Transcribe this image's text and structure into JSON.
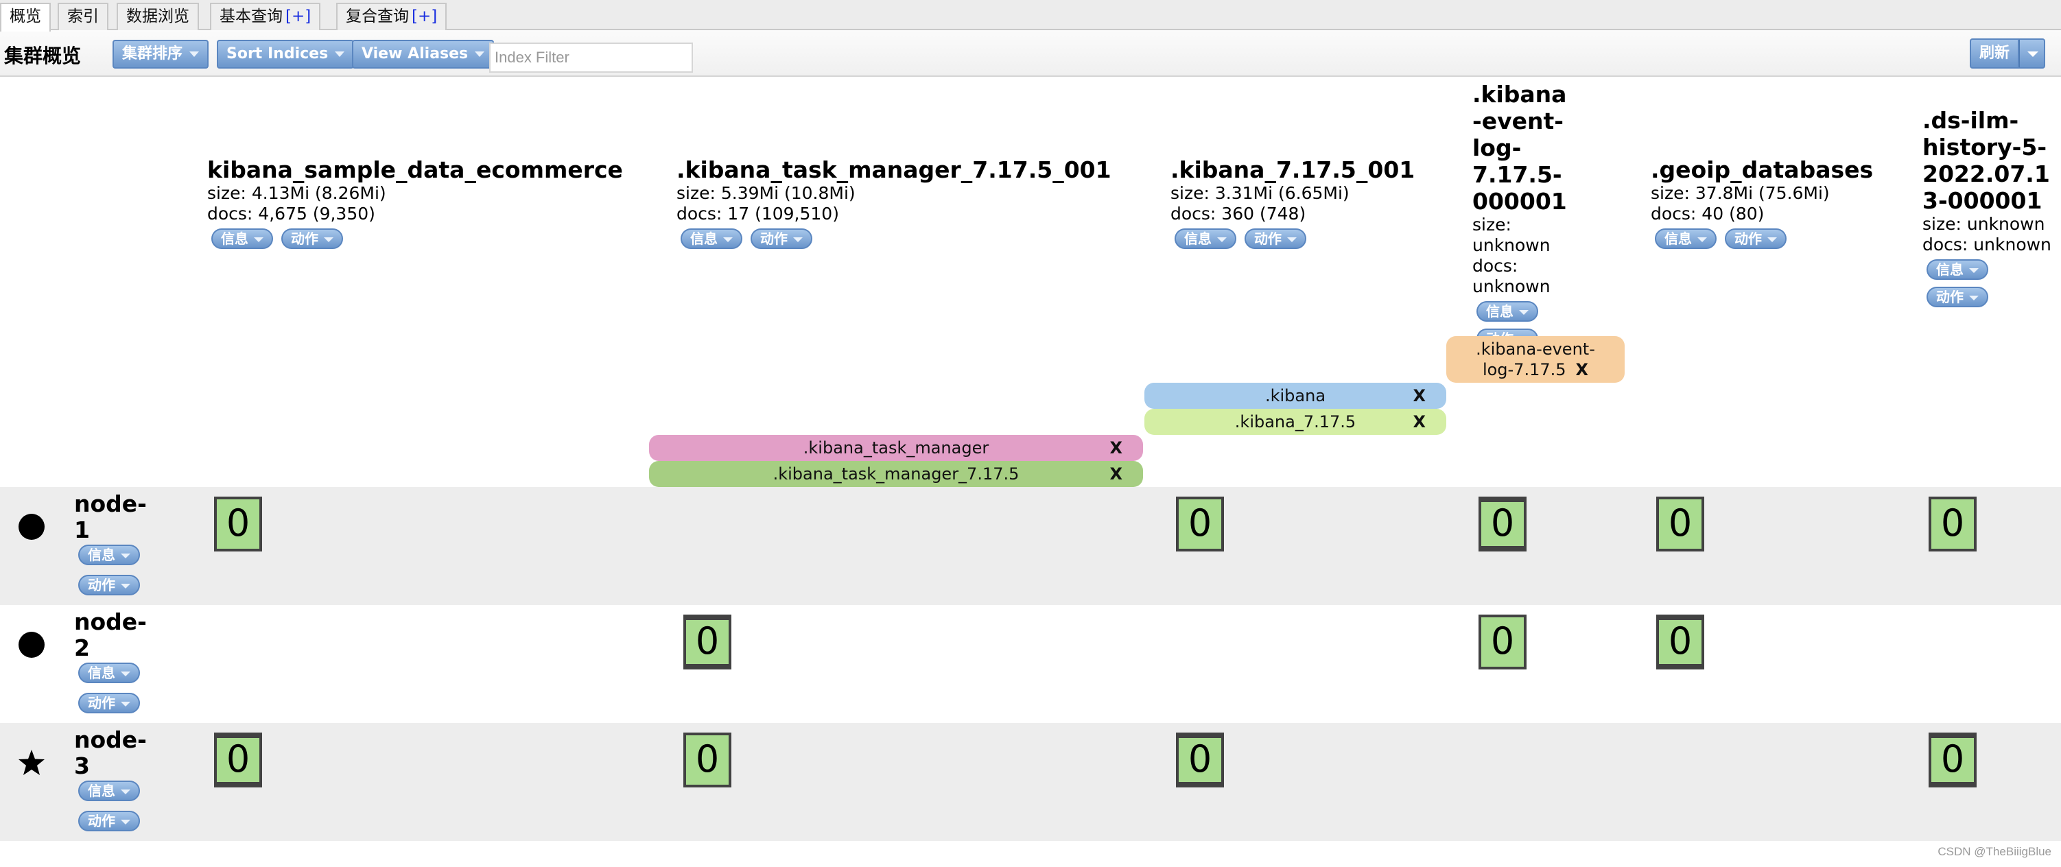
{
  "tabs": [
    {
      "label": "概览",
      "plus": null,
      "active": true
    },
    {
      "label": "索引",
      "plus": null,
      "active": false
    },
    {
      "label": "数据浏览",
      "plus": null,
      "active": false
    },
    {
      "label": "基本查询",
      "plus": "[+]",
      "active": false
    },
    {
      "label": "复合查询",
      "plus": "[+]",
      "active": false
    }
  ],
  "toolbar": {
    "title": "集群概览",
    "cluster_sort_label": "集群排序",
    "sort_indices_label": "Sort Indices",
    "view_aliases_label": "View Aliases",
    "index_filter_placeholder": "Index Filter",
    "index_filter_value": "",
    "refresh_label": "刷新"
  },
  "pill_labels": {
    "info": "信息",
    "actions": "动作"
  },
  "indices": [
    {
      "name": "kibana_sample_data_ecommerce",
      "size": "size: 4.13Mi (8.26Mi)",
      "docs": "docs: 4,675 (9,350)"
    },
    {
      "name": ".kibana_task_manager_7.17.5_001",
      "size": "size: 5.39Mi (10.8Mi)",
      "docs": "docs: 17 (109,510)"
    },
    {
      "name": ".kibana_7.17.5_001",
      "size": "size: 3.31Mi (6.65Mi)",
      "docs": "docs: 360 (748)"
    },
    {
      "name": ".kibana-event-log-7.17.5-000001",
      "size": "size: unknown",
      "docs": "docs: unknown"
    },
    {
      "name": ".geoip_databases",
      "size": "size: 37.8Mi (75.6Mi)",
      "docs": "docs: 40 (80)"
    },
    {
      "name": ".ds-ilm-history-5-2022.07.13-000001",
      "size": "size: unknown",
      "docs": "docs: unknown"
    }
  ],
  "aliases": [
    {
      "name": ".kibana_task_manager",
      "index": ".kibana_task_manager_7.17.5_001",
      "color": "#e29fc7",
      "remove": "X"
    },
    {
      "name": ".kibana_task_manager_7.17.5",
      "index": ".kibana_task_manager_7.17.5_001",
      "color": "#a6ce82",
      "remove": "X"
    },
    {
      "name": ".kibana",
      "index": ".kibana_7.17.5_001",
      "color": "#a6cbec",
      "remove": "X"
    },
    {
      "name": ".kibana_7.17.5",
      "index": ".kibana_7.17.5_001",
      "color": "#d4eea4",
      "remove": "X"
    },
    {
      "name": ".kibana-event-log-7.17.5",
      "index": ".kibana-event-log-7.17.5-000001",
      "color": "#f7cfa0",
      "remove": "X"
    }
  ],
  "nodes": [
    {
      "name": "node-1",
      "icon": "circle",
      "shards": [
        {
          "index": 0,
          "label": "0",
          "primary": false
        },
        {
          "index": 2,
          "label": "0",
          "primary": false
        },
        {
          "index": 3,
          "label": "0",
          "primary": true
        },
        {
          "index": 4,
          "label": "0",
          "primary": false
        },
        {
          "index": 5,
          "label": "0",
          "primary": false
        }
      ]
    },
    {
      "name": "node-2",
      "icon": "circle",
      "shards": [
        {
          "index": 1,
          "label": "0",
          "primary": true
        },
        {
          "index": 3,
          "label": "0",
          "primary": false
        },
        {
          "index": 4,
          "label": "0",
          "primary": true
        }
      ]
    },
    {
      "name": "node-3",
      "icon": "star",
      "shards": [
        {
          "index": 0,
          "label": "0",
          "primary": true
        },
        {
          "index": 1,
          "label": "0",
          "primary": false
        },
        {
          "index": 2,
          "label": "0",
          "primary": true
        },
        {
          "index": 5,
          "label": "0",
          "primary": true
        }
      ]
    }
  ],
  "colors": {
    "shard_fill": "#a9dc8f",
    "shard_border": "#424242",
    "button_blue": "#6b96cc",
    "row_grey": "#ededed"
  },
  "watermark": "CSDN @TheBiiigBlue"
}
